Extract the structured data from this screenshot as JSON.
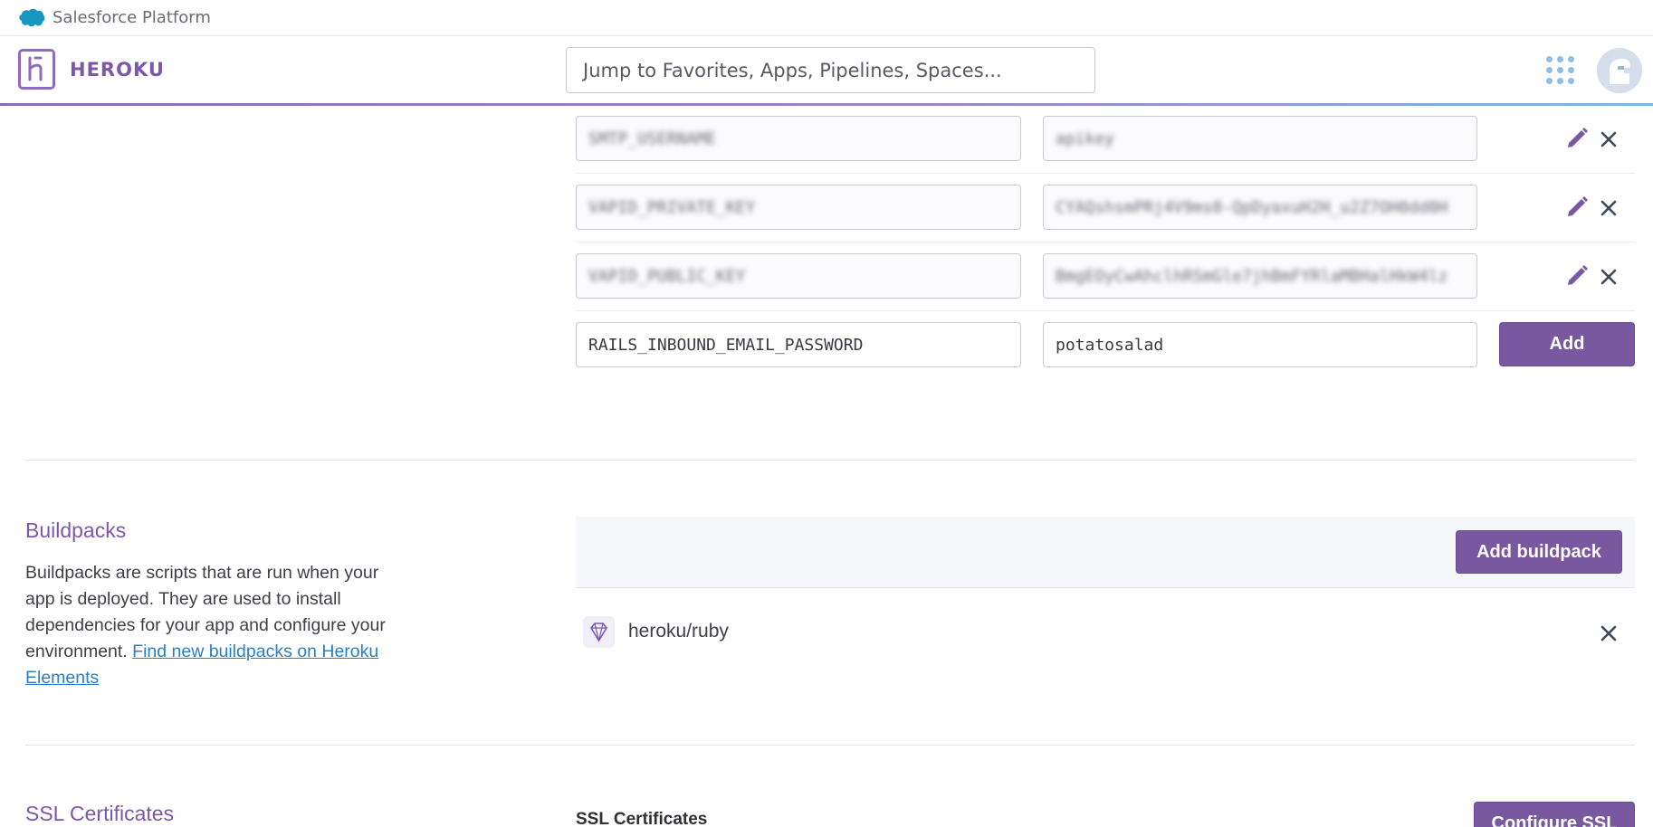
{
  "salesforce_bar": {
    "label": "Salesforce Platform"
  },
  "header": {
    "brand": "HEROKU",
    "search_placeholder": "Jump to Favorites, Apps, Pipelines, Spaces..."
  },
  "config_vars": [
    {
      "key": "SMTP_USERNAME",
      "value": "apikey",
      "obscured": true
    },
    {
      "key": "VAPID_PRIVATE_KEY",
      "value": "CYAQshsmPRj4V9ms0-QpDyaxuH2H_u2Z7OH0dd0H",
      "obscured": true
    },
    {
      "key": "VAPID_PUBLIC_KEY",
      "value": "BmgEOyCwAhclhRSmGle7jhBmFYRlaMBHalHkW4lz",
      "obscured": true
    }
  ],
  "new_config_var": {
    "key": "RAILS_INBOUND_EMAIL_PASSWORD",
    "value": "potatosalad",
    "add_label": "Add"
  },
  "buildpacks": {
    "title": "Buildpacks",
    "description": "Buildpacks are scripts that are run when your app is deployed. They are used to install dependencies for your app and configure your environment.",
    "link_text": "Find new buildpacks on Heroku Elements",
    "add_label": "Add buildpack",
    "items": [
      {
        "name": "heroku/ruby"
      }
    ]
  },
  "ssl": {
    "title": "SSL Certificates",
    "label": "SSL Certificates",
    "configure_label": "Configure SSL"
  },
  "colors": {
    "accent": "#79589f",
    "link": "#2d7fc4",
    "apps_icon": "#8fbde6"
  }
}
